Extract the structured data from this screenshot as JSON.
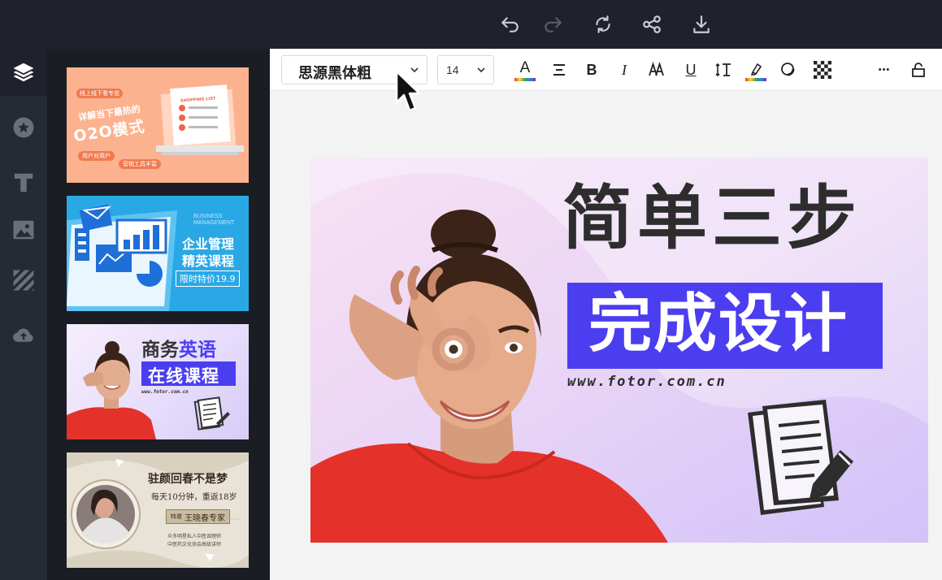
{
  "topbar": {
    "actions": [
      "undo-icon",
      "redo-icon",
      "refresh-icon",
      "share-icon",
      "download-icon"
    ]
  },
  "rail": {
    "items": [
      "layers-icon",
      "star-icon",
      "text-icon",
      "image-icon",
      "pattern-icon",
      "upload-icon"
    ]
  },
  "toolbar": {
    "font": "思源黑体粗",
    "size": "14",
    "text_color": "A",
    "bold": "B",
    "italic": "I",
    "underline": "U",
    "more": "•••"
  },
  "templates": [
    {
      "top_label": "线上线下看专览",
      "line1": "详解当下最热的",
      "line2": "O2O模式",
      "tag1": "用户对用户",
      "tag2": "营销工具丰富",
      "list_title": "SHOPPING LIST"
    },
    {
      "en1": "BUSINESS",
      "en2": "MANAGEMENT",
      "title1": "企业管理",
      "title2": "精英课程",
      "price": "限时特价19.9"
    },
    {
      "title_a": "商务",
      "title_b": "英语",
      "title2": "在线课程",
      "url": "www.fotor.com.cn"
    },
    {
      "title": "驻颜回春不是梦",
      "sub": "每天10分钟，重返18岁",
      "badge_pre": "特邀",
      "badge": "王晓春专家",
      "line1": "众多明星私人中医调理师",
      "line2": "中医药文化协会高级讲师"
    }
  ],
  "canvas": {
    "headline": "简单三步",
    "subheadline": "完成设计",
    "url": "www.fotor.com.cn"
  },
  "colors": {
    "dark": "#1f222b",
    "accent_blue": "#4b3ef0",
    "shirt_red": "#e4322b"
  }
}
